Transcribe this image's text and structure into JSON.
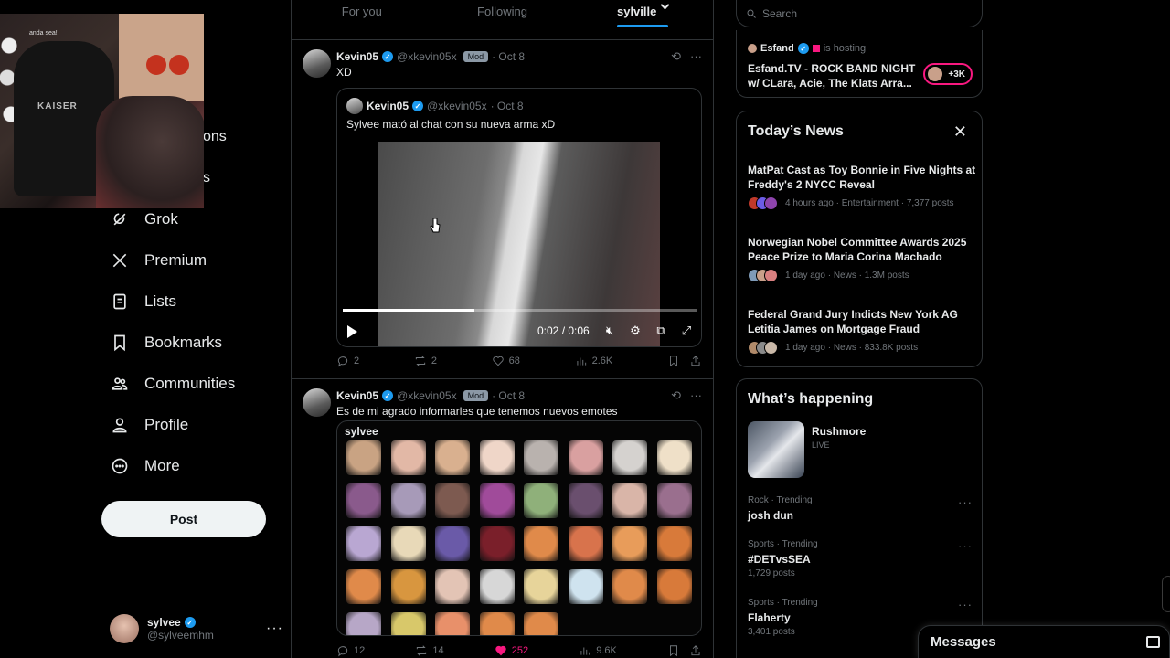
{
  "webcam": {
    "tag": "anda sea!",
    "chair_text": "KAISER"
  },
  "nav": {
    "hidden_fragments": [
      "ons",
      "s"
    ],
    "items": [
      {
        "label": "Grok",
        "icon": "grok-icon"
      },
      {
        "label": "Premium",
        "icon": "x-logo-icon"
      },
      {
        "label": "Lists",
        "icon": "list-icon"
      },
      {
        "label": "Bookmarks",
        "icon": "bookmark-icon"
      },
      {
        "label": "Communities",
        "icon": "communities-icon"
      },
      {
        "label": "Profile",
        "icon": "profile-icon"
      },
      {
        "label": "More",
        "icon": "more-circle-icon"
      }
    ],
    "post_label": "Post",
    "account": {
      "name": "sylvee",
      "handle": "@sylveemhm",
      "more": "···"
    }
  },
  "tabs": [
    {
      "label": "For you"
    },
    {
      "label": "Following"
    },
    {
      "label": "sylville"
    }
  ],
  "posts": [
    {
      "name": "Kevin05",
      "handle": "@xkevin05x",
      "badge": "Mod",
      "date": "· Oct 8",
      "text": "XD",
      "quote": {
        "name": "Kevin05",
        "handle": "@xkevin05x",
        "date": "· Oct 8",
        "text": "Sylvee mató al chat con su nueva arma xD",
        "video_time": "0:02 / 0:06",
        "video_progress": 0.37
      },
      "stats": {
        "replies": "2",
        "reposts": "2",
        "likes": "68",
        "views": "2.6K"
      }
    },
    {
      "name": "Kevin05",
      "handle": "@xkevin05x",
      "badge": "Mod",
      "date": "· Oct 8",
      "text": "Es de mi agrado informarles que tenemos nuevos emotes",
      "emote_title": "sylvee",
      "stats": {
        "replies": "12",
        "reposts": "14",
        "likes": "252",
        "views": "9.6K"
      }
    }
  ],
  "emote_colors": [
    "#c9a383",
    "#e2b8a6",
    "#d9b08f",
    "#efd6c8",
    "#b9b2ae",
    "#d9a0a0",
    "#d5d2cf",
    "#efe0c8",
    "#8a5a8c",
    "#a79ab8",
    "#7d5a50",
    "#a04b9a",
    "#8fb07a",
    "#6a4f6e",
    "#d9b5a8",
    "#9a6f8e",
    "#b9a7d2",
    "#e8d9b8",
    "#6a5aa8",
    "#7a1f2a",
    "#e08a4a",
    "#d8734c",
    "#e89c5a",
    "#d87a3a",
    "#e08a4a",
    "#d8963f",
    "#e3c4b5",
    "#d7d7d7",
    "#e7d49a",
    "#cfe3ef",
    "#e08a4a",
    "#d87a3a",
    "#b7a7c7",
    "#d8c86a",
    "#e8906a",
    "#e08a4a",
    "#e08a4a"
  ],
  "right": {
    "search_placeholder": "Search",
    "live": {
      "host": "Esfand",
      "hosting": "is hosting",
      "title": "Esfand.TV - ROCK BAND NIGHT w/ CLara, Acie, The Klats Arra...",
      "count": "+3K"
    },
    "news": {
      "title": "Today’s News",
      "items": [
        {
          "headline": "MatPat Cast as Toy Bonnie in Five Nights at Freddy's 2 NYCC Reveal",
          "meta": "4 hours ago · Entertainment · 7,377 posts"
        },
        {
          "headline": "Norwegian Nobel Committee Awards 2025 Peace Prize to Maria Corina Machado",
          "meta": "1 day ago · News · 1.3M posts"
        },
        {
          "headline": "Federal Grand Jury Indicts New York AG Letitia James on Mortgage Fraud",
          "meta": "1 day ago · News · 833.8K posts"
        }
      ]
    },
    "happening": {
      "title": "What’s happening",
      "featured": {
        "name": "Rushmore",
        "status": "LIVE"
      },
      "trends": [
        {
          "category": "Rock · Trending",
          "title": "josh dun",
          "count": ""
        },
        {
          "category": "Sports · Trending",
          "title": "#DETvsSEA",
          "count": "1,729 posts"
        },
        {
          "category": "Sports · Trending",
          "title": "Flaherty",
          "count": "3,401 posts"
        }
      ]
    }
  },
  "messages": {
    "label": "Messages"
  },
  "colors": {
    "accent": "#1d9bf0",
    "like": "#f91880",
    "background": "#000000",
    "border": "#2f3336",
    "muted": "#71767b"
  }
}
